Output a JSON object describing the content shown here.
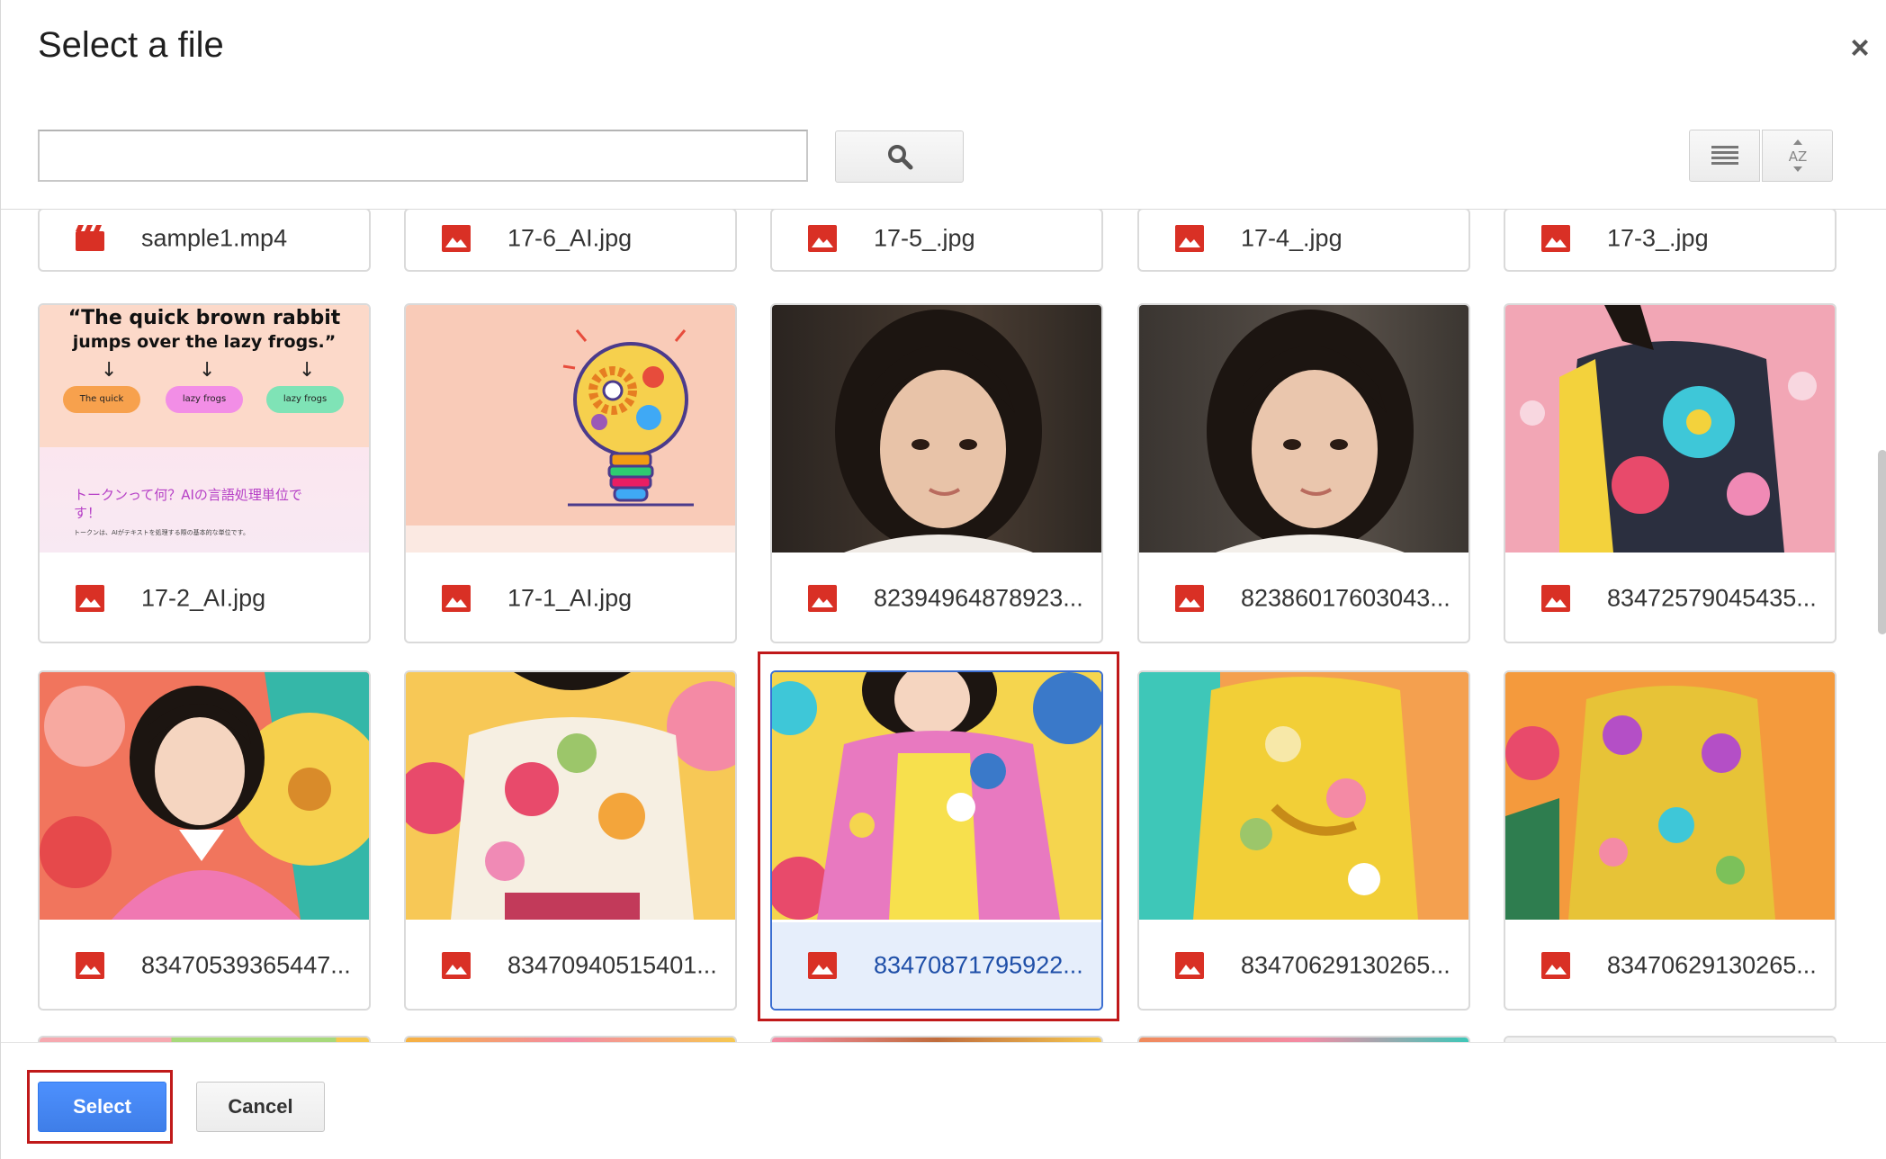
{
  "dialog": {
    "title": "Select a file",
    "close_glyph": "×"
  },
  "search": {
    "value": "",
    "placeholder": ""
  },
  "icons": {
    "search": "search-icon",
    "list_view": "list-view-icon",
    "sort": "sort-az-icon",
    "video": "video-file-icon",
    "image": "image-file-icon"
  },
  "sort_label": "AZ",
  "files": [
    {
      "name": "sample1.mp4",
      "type": "video"
    },
    {
      "name": "17-6_AI.jpg",
      "type": "image"
    },
    {
      "name": "17-5_.jpg",
      "type": "image"
    },
    {
      "name": "17-4_.jpg",
      "type": "image"
    },
    {
      "name": "17-3_.jpg",
      "type": "image"
    },
    {
      "name": "17-2_AI.jpg",
      "type": "image"
    },
    {
      "name": "17-1_AI.jpg",
      "type": "image"
    },
    {
      "name": "82394964878923...",
      "type": "image"
    },
    {
      "name": "82386017603043...",
      "type": "image"
    },
    {
      "name": "83472579045435...",
      "type": "image"
    },
    {
      "name": "83470539365447...",
      "type": "image"
    },
    {
      "name": "83470940515401...",
      "type": "image"
    },
    {
      "name": "83470871795922...",
      "type": "image",
      "selected": true
    },
    {
      "name": "83470629130265...",
      "type": "image"
    },
    {
      "name": "83470629130265...",
      "type": "image"
    }
  ],
  "thumb_text": {
    "quote_line1": "“The quick brown rabbit",
    "quote_line2": "jumps over the lazy frogs.”",
    "pill1": "The quick",
    "pill2": "lazy frogs",
    "pill3": "lazy frogs",
    "jp_title": "トークンって何？AIの言語処理単位で",
    "jp_title2": "す！",
    "jp_small": "トークンは、AIがテキストを処理する際の基本的な単位です。"
  },
  "buttons": {
    "select": "Select",
    "cancel": "Cancel"
  },
  "colors": {
    "accent": "#4d90fe",
    "highlight": "#c0191a",
    "file_icon_red": "#d93025"
  }
}
